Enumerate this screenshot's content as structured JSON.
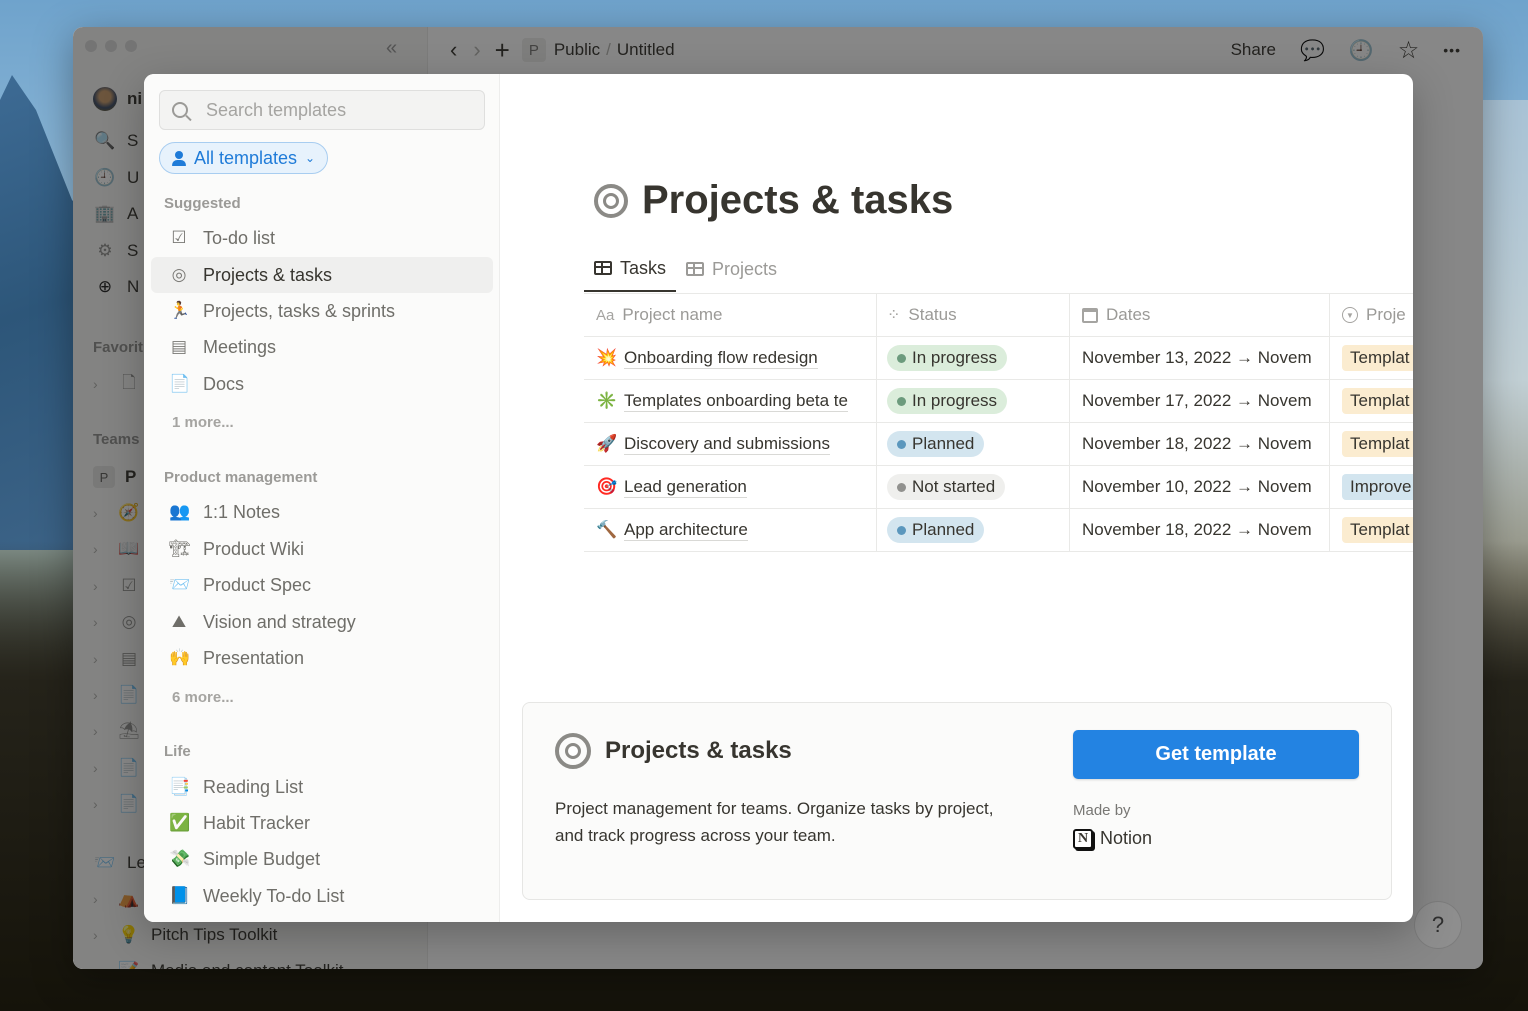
{
  "window": {
    "breadcrumb": [
      {
        "badge": "P",
        "label": "Public"
      },
      {
        "label": "Untitled"
      }
    ],
    "breadcrumb_separator": "/",
    "share_label": "Share",
    "icons": {
      "back": "‹",
      "forward": "›",
      "new_page": "+",
      "comments": "💬",
      "history": "🕘",
      "favorite": "☆",
      "more": "•••",
      "collapse_sidebar": "«"
    }
  },
  "app_sidebar": {
    "user_initial_text": "ni",
    "items": [
      {
        "icon": "🔍",
        "label": "S"
      },
      {
        "icon": "🕘",
        "label": "U"
      },
      {
        "icon": "🏢",
        "label": "A"
      },
      {
        "icon": "⚙",
        "label": "S"
      },
      {
        "icon": "⊕",
        "label": "N"
      }
    ],
    "favorites_label": "Favorit",
    "teamspaces_label": "Teams",
    "teamspace_badge": "P",
    "teamspace_initial": "P",
    "team_items": [
      "🧭",
      "📖",
      "☑",
      "◎",
      "▤",
      "📄",
      "⛱",
      "📄",
      "📄"
    ],
    "bottom_items": [
      {
        "icon": "📨",
        "label": "Le"
      },
      {
        "icon": "⛺",
        "label": ""
      },
      {
        "icon": "💡",
        "label": "Pitch Tips Toolkit"
      },
      {
        "icon": "📝",
        "label": "Media and content Toolkit"
      }
    ],
    "help_label": "?"
  },
  "template_browser": {
    "search_placeholder": "Search templates",
    "search_value": "",
    "filter_label": "All templates",
    "sections": [
      {
        "title": "Suggested",
        "items": [
          {
            "icon": "☑",
            "label": "To-do list",
            "active": false
          },
          {
            "icon": "◎",
            "label": "Projects & tasks",
            "active": true
          },
          {
            "icon": "🏃",
            "label": "Projects, tasks & sprints",
            "active": false
          },
          {
            "icon": "▤",
            "label": "Meetings",
            "active": false
          },
          {
            "icon": "📄",
            "label": "Docs",
            "active": false
          }
        ],
        "more": "1 more..."
      },
      {
        "title": "Product management",
        "items": [
          {
            "icon": "👥",
            "label": "1:1 Notes"
          },
          {
            "icon": "🏗",
            "label": "Product Wiki"
          },
          {
            "icon": "📨",
            "label": "Product Spec"
          },
          {
            "icon": "⛰",
            "label": "Vision and strategy"
          },
          {
            "icon": "🙌",
            "label": "Presentation"
          }
        ],
        "more": "6 more..."
      },
      {
        "title": "Life",
        "items": [
          {
            "icon": "📑",
            "label": "Reading List"
          },
          {
            "icon": "✅",
            "label": "Habit Tracker"
          },
          {
            "icon": "💸",
            "label": "Simple Budget"
          },
          {
            "icon": "📘",
            "label": "Weekly To-do List"
          }
        ]
      }
    ]
  },
  "preview": {
    "title": "Projects & tasks",
    "tabs": [
      {
        "label": "Tasks",
        "active": true
      },
      {
        "label": "Projects",
        "active": false
      }
    ],
    "table": {
      "columns": [
        {
          "icon": "Aa",
          "label": "Project name"
        },
        {
          "icon": "spinner",
          "label": "Status"
        },
        {
          "icon": "calendar",
          "label": "Dates"
        },
        {
          "icon": "select",
          "label": "Proje"
        }
      ],
      "rows": [
        {
          "emoji": "💥",
          "name": "Onboarding flow redesign",
          "status": "In progress",
          "dates": "November 13, 2022 → Novem",
          "project": "Templat"
        },
        {
          "emoji": "✳️",
          "name": "Templates onboarding beta te",
          "status": "In progress",
          "dates": "November 17, 2022 → Novem",
          "project": "Templat"
        },
        {
          "emoji": "🚀",
          "name": "Discovery and submissions",
          "status": "Planned",
          "dates": "November 18, 2022 → Novem",
          "project": "Templat"
        },
        {
          "emoji": "🎯",
          "name": "Lead generation",
          "status": "Not started",
          "dates": "November 10, 2022 → Novem",
          "project": "Improve"
        },
        {
          "emoji": "🔨",
          "name": "App architecture",
          "status": "Planned",
          "dates": "November 18, 2022 → Novem",
          "project": "Templat"
        }
      ]
    },
    "status_colors": {
      "In progress": {
        "bg": "#dbeddb",
        "dot": "#6c9b7d"
      },
      "Planned": {
        "bg": "#d3e5ef",
        "dot": "#5b97bd"
      },
      "Not started": {
        "bg": "#efefed",
        "dot": "#91918e"
      }
    },
    "project_colors": {
      "Templat": "#fbecd0",
      "Improve": "#d3e5ef"
    }
  },
  "info": {
    "title": "Projects & tasks",
    "description": "Project management for teams. Organize tasks by project, and track progress across your team.",
    "get_template_label": "Get template",
    "made_by_label": "Made by",
    "author": "Notion",
    "accent": "#2383e2"
  }
}
